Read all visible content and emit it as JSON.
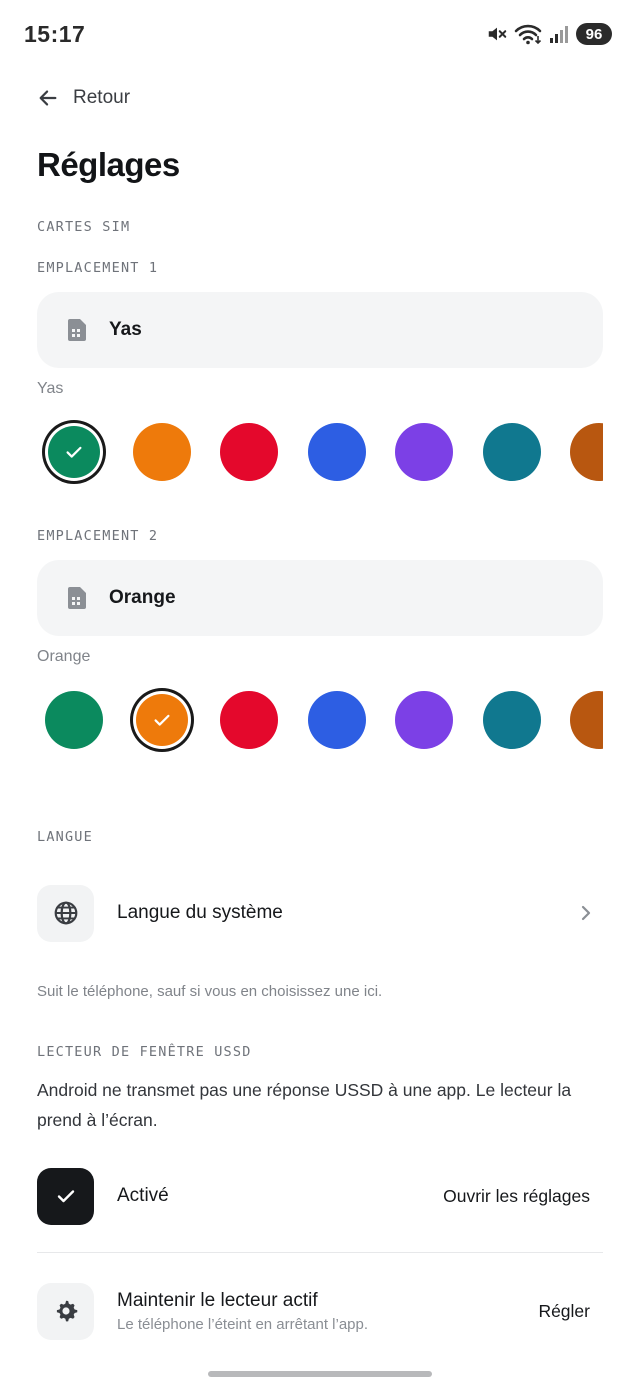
{
  "status_bar": {
    "time": "15:17",
    "battery": "96",
    "icons": [
      "mute-icon",
      "wifi-icon",
      "signal-icon"
    ]
  },
  "header": {
    "back_label": "Retour",
    "title": "Réglages"
  },
  "sim_section": {
    "label": "CARTES SIM",
    "slots": [
      {
        "label": "EMPLACEMENT 1",
        "card_name": "Yas",
        "color_label": "Yas",
        "selected_color": "#0b8a5e"
      },
      {
        "label": "EMPLACEMENT 2",
        "card_name": "Orange",
        "color_label": "Orange",
        "selected_color": "#ee7a0b"
      }
    ],
    "palette": [
      "#0b8a5e",
      "#ee7a0b",
      "#e4082c",
      "#2d5ee3",
      "#7c40e6",
      "#10788f",
      "#b85710"
    ]
  },
  "language": {
    "label": "LANGUE",
    "item": "Langue du système",
    "helper": "Suit le téléphone, sauf si vous en choisissez une ici."
  },
  "ussd": {
    "label": "LECTEUR DE FENÊTRE USSD",
    "description": "Android ne transmet pas une réponse USSD à une app. Le lecteur la prend à l’écran.",
    "active_label": "Activé",
    "open_settings": "Ouvrir les réglages",
    "keep_title": "Maintenir le lecteur actif",
    "keep_sub": "Le téléphone l’éteint en arrêtant l’app.",
    "keep_action": "Régler"
  }
}
